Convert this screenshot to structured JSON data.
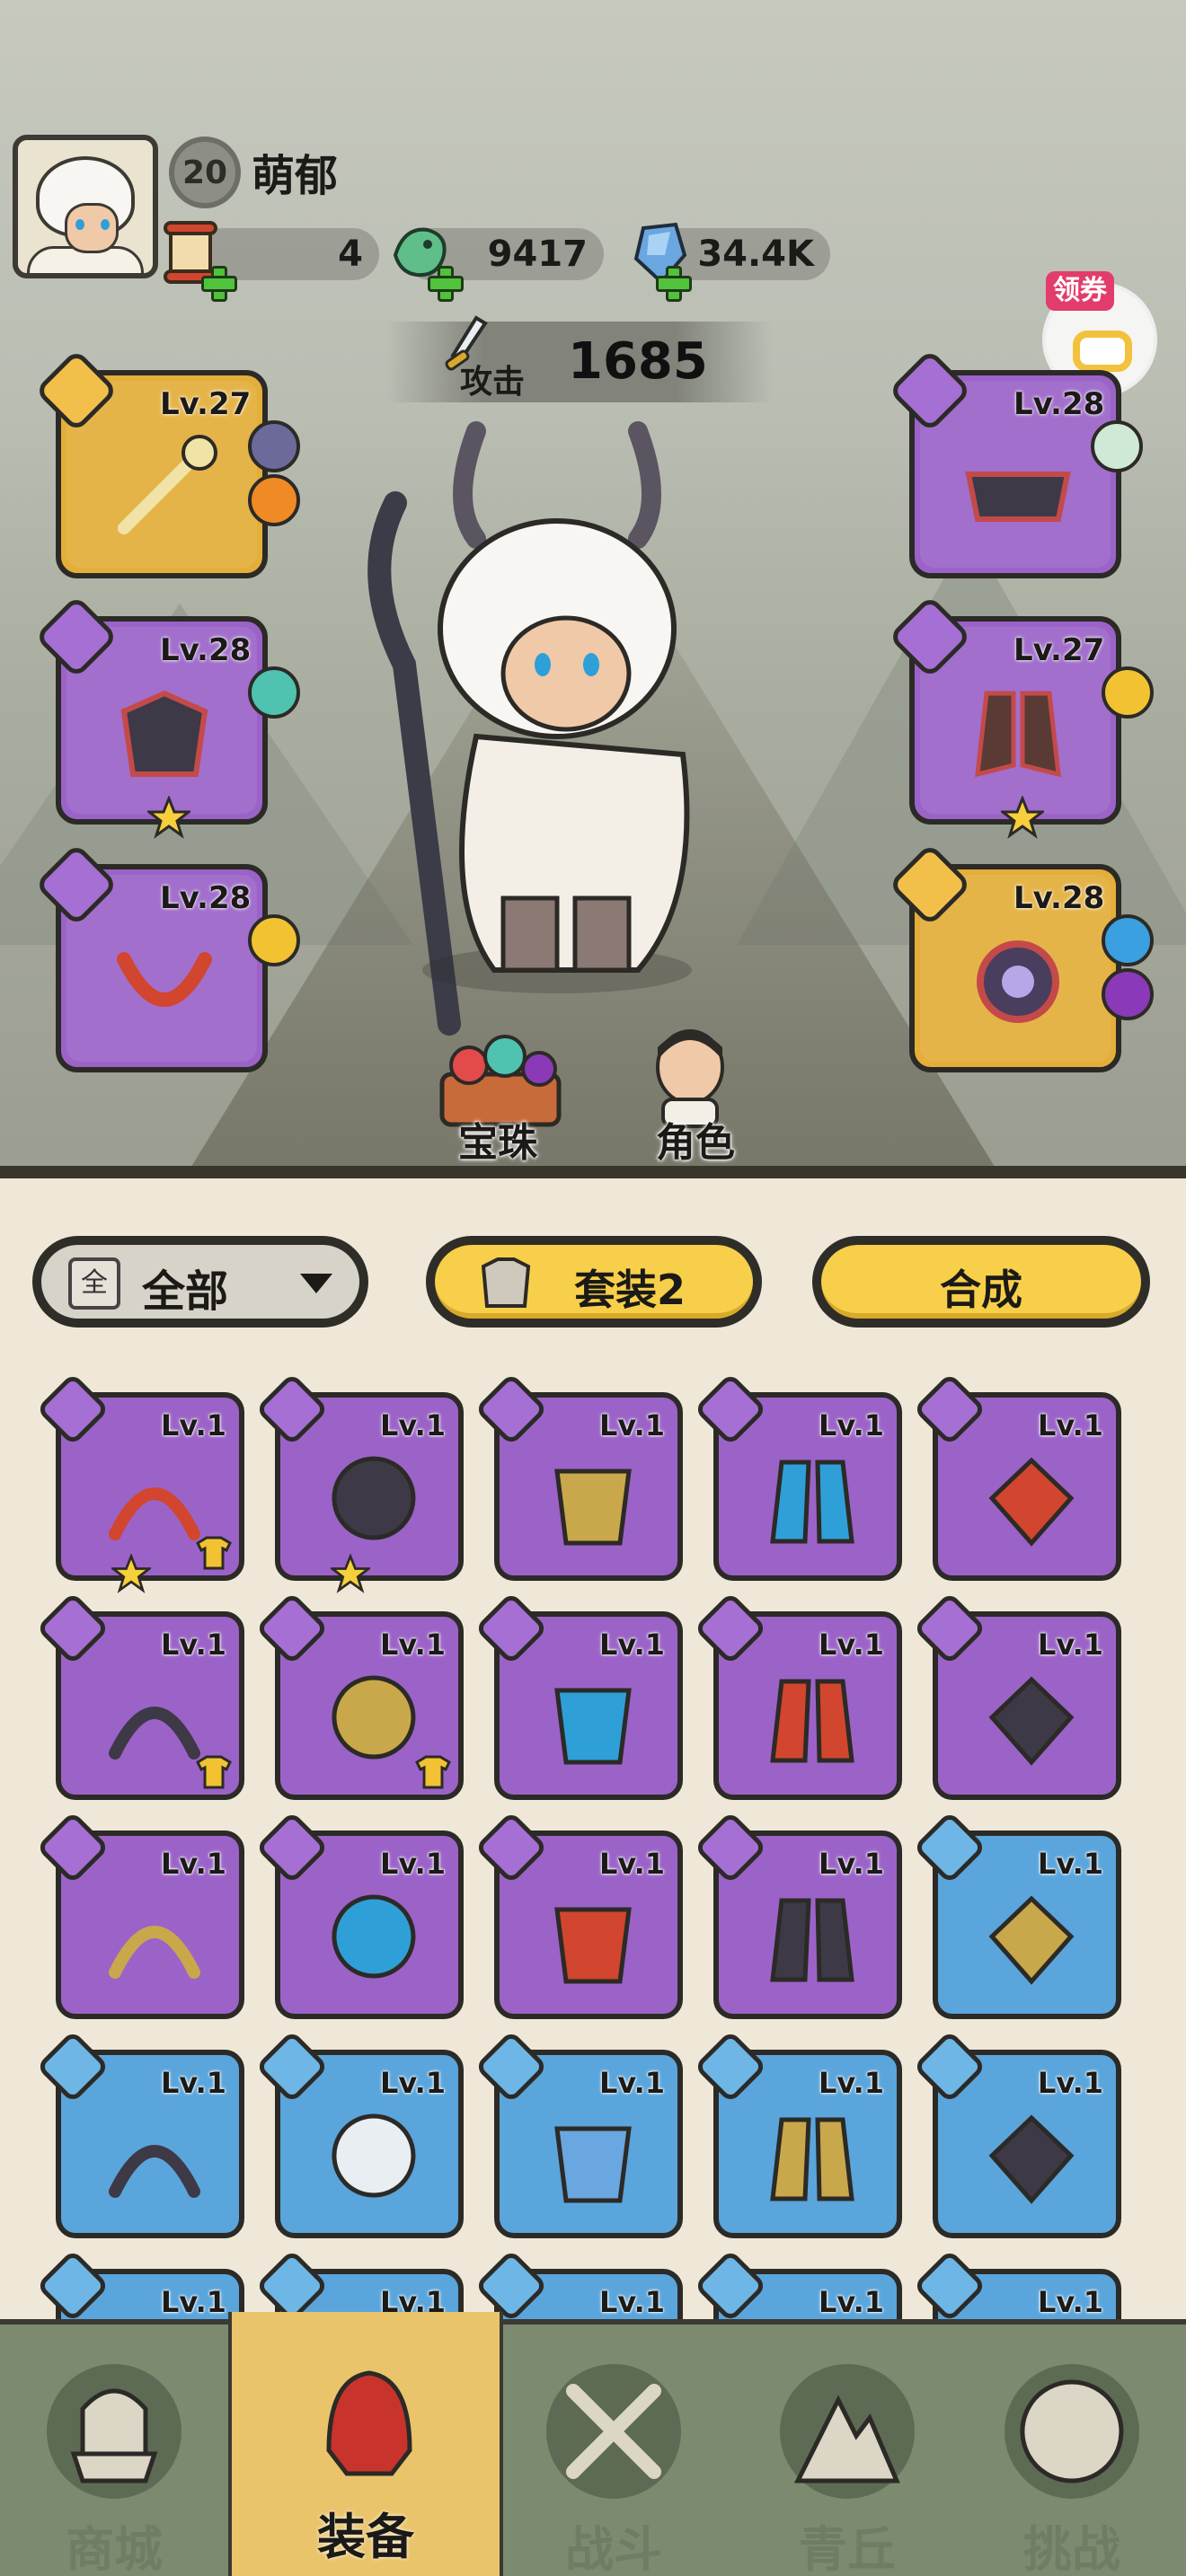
{
  "player": {
    "level": "20",
    "name": "萌郁"
  },
  "resources": [
    {
      "name": "scroll",
      "value": "4"
    },
    {
      "name": "jade",
      "value": "9417"
    },
    {
      "name": "crystal",
      "value": "34.4K"
    }
  ],
  "attack": {
    "label": "攻击",
    "value": "1685"
  },
  "coupon": {
    "label": "领券"
  },
  "equipped": {
    "left": [
      {
        "level": "Lv.27",
        "rarity": "gold",
        "star": false
      },
      {
        "level": "Lv.28",
        "rarity": "purple",
        "star": true
      },
      {
        "level": "Lv.28",
        "rarity": "purple",
        "star": false
      }
    ],
    "right": [
      {
        "level": "Lv.28",
        "rarity": "purple",
        "star": false
      },
      {
        "level": "Lv.27",
        "rarity": "purple",
        "star": true
      },
      {
        "level": "Lv.28",
        "rarity": "gold",
        "star": false
      }
    ]
  },
  "scene_buttons": {
    "orbs": "宝珠",
    "character": "角色"
  },
  "toolbar": {
    "filter_icon": "全",
    "filter": "全部",
    "set": "套装2",
    "synthesize": "合成"
  },
  "inventory": [
    {
      "level": "Lv.1",
      "rarity": "purple",
      "star": true,
      "tshirt": true
    },
    {
      "level": "Lv.1",
      "rarity": "purple",
      "star": true,
      "tshirt": false
    },
    {
      "level": "Lv.1",
      "rarity": "purple",
      "star": false,
      "tshirt": false
    },
    {
      "level": "Lv.1",
      "rarity": "purple",
      "star": false,
      "tshirt": false
    },
    {
      "level": "Lv.1",
      "rarity": "purple",
      "star": false,
      "tshirt": false
    },
    {
      "level": "Lv.1",
      "rarity": "purple",
      "star": false,
      "tshirt": true
    },
    {
      "level": "Lv.1",
      "rarity": "purple",
      "star": false,
      "tshirt": true
    },
    {
      "level": "Lv.1",
      "rarity": "purple",
      "star": false,
      "tshirt": false
    },
    {
      "level": "Lv.1",
      "rarity": "purple",
      "star": false,
      "tshirt": false
    },
    {
      "level": "Lv.1",
      "rarity": "purple",
      "star": false,
      "tshirt": false
    },
    {
      "level": "Lv.1",
      "rarity": "purple",
      "star": false,
      "tshirt": false
    },
    {
      "level": "Lv.1",
      "rarity": "purple",
      "star": false,
      "tshirt": false
    },
    {
      "level": "Lv.1",
      "rarity": "purple",
      "star": false,
      "tshirt": false
    },
    {
      "level": "Lv.1",
      "rarity": "purple",
      "star": false,
      "tshirt": false
    },
    {
      "level": "Lv.1",
      "rarity": "blue",
      "star": false,
      "tshirt": false
    },
    {
      "level": "Lv.1",
      "rarity": "blue",
      "star": false,
      "tshirt": false
    },
    {
      "level": "Lv.1",
      "rarity": "blue",
      "star": false,
      "tshirt": false
    },
    {
      "level": "Lv.1",
      "rarity": "blue",
      "star": false,
      "tshirt": false
    },
    {
      "level": "Lv.1",
      "rarity": "blue",
      "star": false,
      "tshirt": false
    },
    {
      "level": "Lv.1",
      "rarity": "blue",
      "star": false,
      "tshirt": false
    },
    {
      "level": "Lv.1",
      "rarity": "blue",
      "star": false,
      "tshirt": false
    },
    {
      "level": "Lv.1",
      "rarity": "blue",
      "star": false,
      "tshirt": false
    },
    {
      "level": "Lv.1",
      "rarity": "blue",
      "star": false,
      "tshirt": false
    },
    {
      "level": "Lv.1",
      "rarity": "blue",
      "star": false,
      "tshirt": false
    },
    {
      "level": "Lv.1",
      "rarity": "blue",
      "star": false,
      "tshirt": false
    }
  ],
  "nav": [
    {
      "label": "商城",
      "icon": "shop-icon",
      "active": false
    },
    {
      "label": "装备",
      "icon": "equipment-helmet-icon",
      "active": true
    },
    {
      "label": "战斗",
      "icon": "crossed-swords-icon",
      "active": false
    },
    {
      "label": "青丘",
      "icon": "mountain-icon",
      "active": false
    },
    {
      "label": "挑战",
      "icon": "challenge-gong-icon",
      "active": false
    }
  ],
  "colors": {
    "purple": "#9b63c8",
    "gold": "#e3ae3a",
    "blue": "#5aa5dc",
    "button_yellow": "#f7cf4a",
    "nav_green": "#7c8a6f"
  }
}
